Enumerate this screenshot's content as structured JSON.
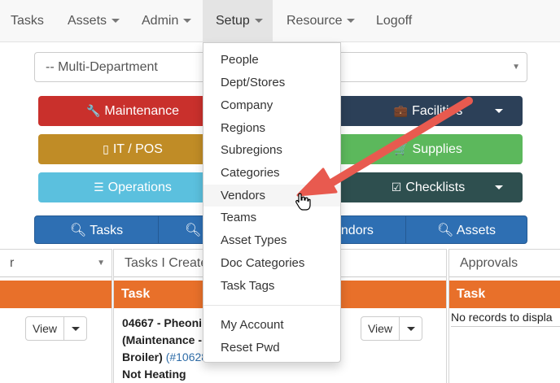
{
  "nav": {
    "items": [
      {
        "label": "Tasks",
        "caret": false
      },
      {
        "label": "Assets",
        "caret": true
      },
      {
        "label": "Admin",
        "caret": true
      },
      {
        "label": "Setup",
        "caret": true
      },
      {
        "label": "Resource",
        "caret": true
      },
      {
        "label": "Logoff",
        "caret": false
      }
    ]
  },
  "department_select": {
    "value": "-- Multi-Department"
  },
  "module_buttons": {
    "maintenance": "Maintenance",
    "facilities": "Facilities",
    "it_pos": "IT / POS",
    "supplies": "Supplies",
    "operations": "Operations",
    "checklists": "Checklists"
  },
  "search_buttons": {
    "tasks": "Tasks",
    "r_partial": "R",
    "vendors_partial": "endors",
    "assets": "Assets"
  },
  "panels": {
    "left": {
      "select": "r"
    },
    "middle": {
      "select": "Tasks I Create",
      "header": "Task",
      "task_line1": "04667 - Pheoni",
      "task_line2": "(Maintenance -",
      "task_line3_a": "Broiler) ",
      "task_link": "(#10628",
      "task_line4": "Not Heating"
    },
    "right": {
      "select": "Approvals",
      "header": "Task",
      "empty": "No records to displa"
    },
    "view_label": "View"
  },
  "setup_menu": {
    "items": [
      "People",
      "Dept/Stores",
      "Company",
      "Regions",
      "Subregions",
      "Categories",
      "Vendors",
      "Teams",
      "Asset Types",
      "Doc Categories",
      "Task Tags"
    ],
    "account_items": [
      "My Account",
      "Reset Pwd"
    ],
    "hovered": "Vendors"
  },
  "colors": {
    "maintenance": "#c9302c",
    "facilities": "#2c4058",
    "it_pos": "#c08c26",
    "supplies": "#5cb85c",
    "operations": "#5bc0de",
    "checklists": "#2e4f4f",
    "search": "#2e6fb3",
    "panel_header": "#e8702a",
    "arrow": "#e85a4f"
  }
}
